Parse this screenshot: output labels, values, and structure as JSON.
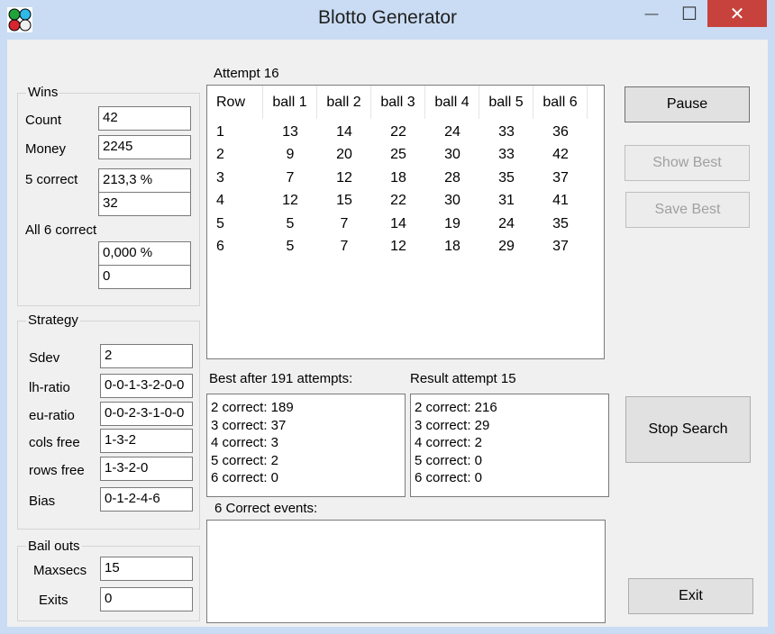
{
  "window": {
    "title": "Blotto Generator",
    "minimize": "—",
    "maximize": "☐",
    "close": "✕"
  },
  "wins": {
    "group_label": "Wins",
    "count_label": "Count",
    "count_value": "42",
    "money_label": "Money",
    "money_value": "2245",
    "five_correct_label": "5 correct",
    "five_correct_pct": "213,3 %",
    "five_correct_count": "32",
    "six_correct_label": "All 6 correct",
    "six_correct_pct": "0,000 %",
    "six_correct_count": "0"
  },
  "strategy": {
    "group_label": "Strategy",
    "sdev_label": "Sdev",
    "sdev_value": "2",
    "lh_label": "lh-ratio",
    "lh_value": "0-0-1-3-2-0-0",
    "eu_label": "eu-ratio",
    "eu_value": "0-0-2-3-1-0-0",
    "cols_label": "cols free",
    "cols_value": "1-3-2",
    "rows_label": "rows free",
    "rows_value": "1-3-2-0",
    "bias_label": "Bias",
    "bias_value": "0-1-2-4-6"
  },
  "bailouts": {
    "group_label": "Bail outs",
    "maxsecs_label": "Maxsecs",
    "maxsecs_value": "15",
    "exits_label": "Exits",
    "exits_value": "0"
  },
  "attempt": {
    "label": "Attempt 16",
    "headers": [
      "Row",
      "ball 1",
      "ball 2",
      "ball 3",
      "ball 4",
      "ball 5",
      "ball 6"
    ],
    "rows": [
      [
        "1",
        "13",
        "14",
        "22",
        "24",
        "33",
        "36"
      ],
      [
        "2",
        "9",
        "20",
        "25",
        "30",
        "33",
        "42"
      ],
      [
        "3",
        "7",
        "12",
        "18",
        "28",
        "35",
        "37"
      ],
      [
        "4",
        "12",
        "15",
        "22",
        "30",
        "31",
        "41"
      ],
      [
        "5",
        "5",
        "7",
        "14",
        "19",
        "24",
        "35"
      ],
      [
        "6",
        "5",
        "7",
        "12",
        "18",
        "29",
        "37"
      ]
    ]
  },
  "best": {
    "label": "Best after 191 attempts:",
    "lines": [
      "2 correct: 189",
      "3 correct: 37",
      "4 correct: 3",
      "5 correct: 2",
      "6 correct: 0"
    ]
  },
  "result": {
    "label": "Result attempt 15",
    "lines": [
      "2 correct: 216",
      "3 correct: 29",
      "4 correct: 2",
      "5 correct: 0",
      "6 correct: 0"
    ]
  },
  "events": {
    "label": "6 Correct events:"
  },
  "buttons": {
    "pause": "Pause",
    "show_best": "Show Best",
    "save_best": "Save Best",
    "stop_search": "Stop Search",
    "exit": "Exit"
  }
}
